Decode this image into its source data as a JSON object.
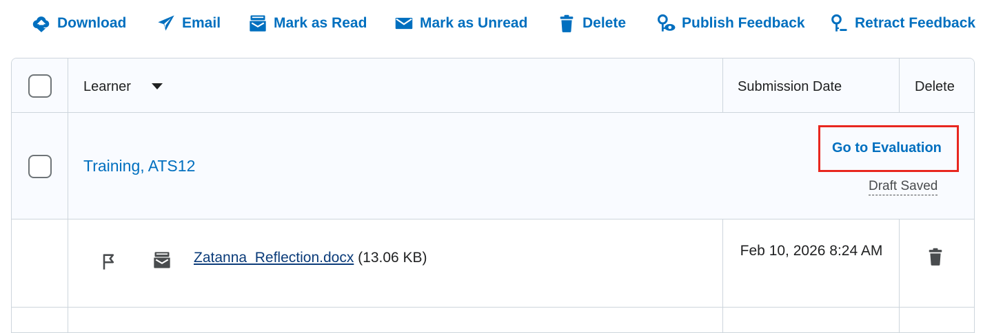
{
  "toolbar": {
    "download": "Download",
    "email": "Email",
    "mark_read": "Mark as Read",
    "mark_unread": "Mark as Unread",
    "delete": "Delete",
    "publish": "Publish Feedback",
    "retract": "Retract Feedback",
    "accent_color": "#006fbf"
  },
  "table": {
    "headers": {
      "learner": "Learner",
      "submission_date": "Submission Date",
      "delete": "Delete"
    },
    "rows": [
      {
        "learner_name": "Training, ATS12",
        "evaluate_link": "Go to Evaluation",
        "status": "Draft Saved",
        "files": [
          {
            "name": "Zatanna_Reflection.docx",
            "size": "(13.06 KB)",
            "submitted": "Feb 10, 2026 8:24 AM"
          }
        ]
      }
    ]
  },
  "highlight_color": "#e8271f"
}
